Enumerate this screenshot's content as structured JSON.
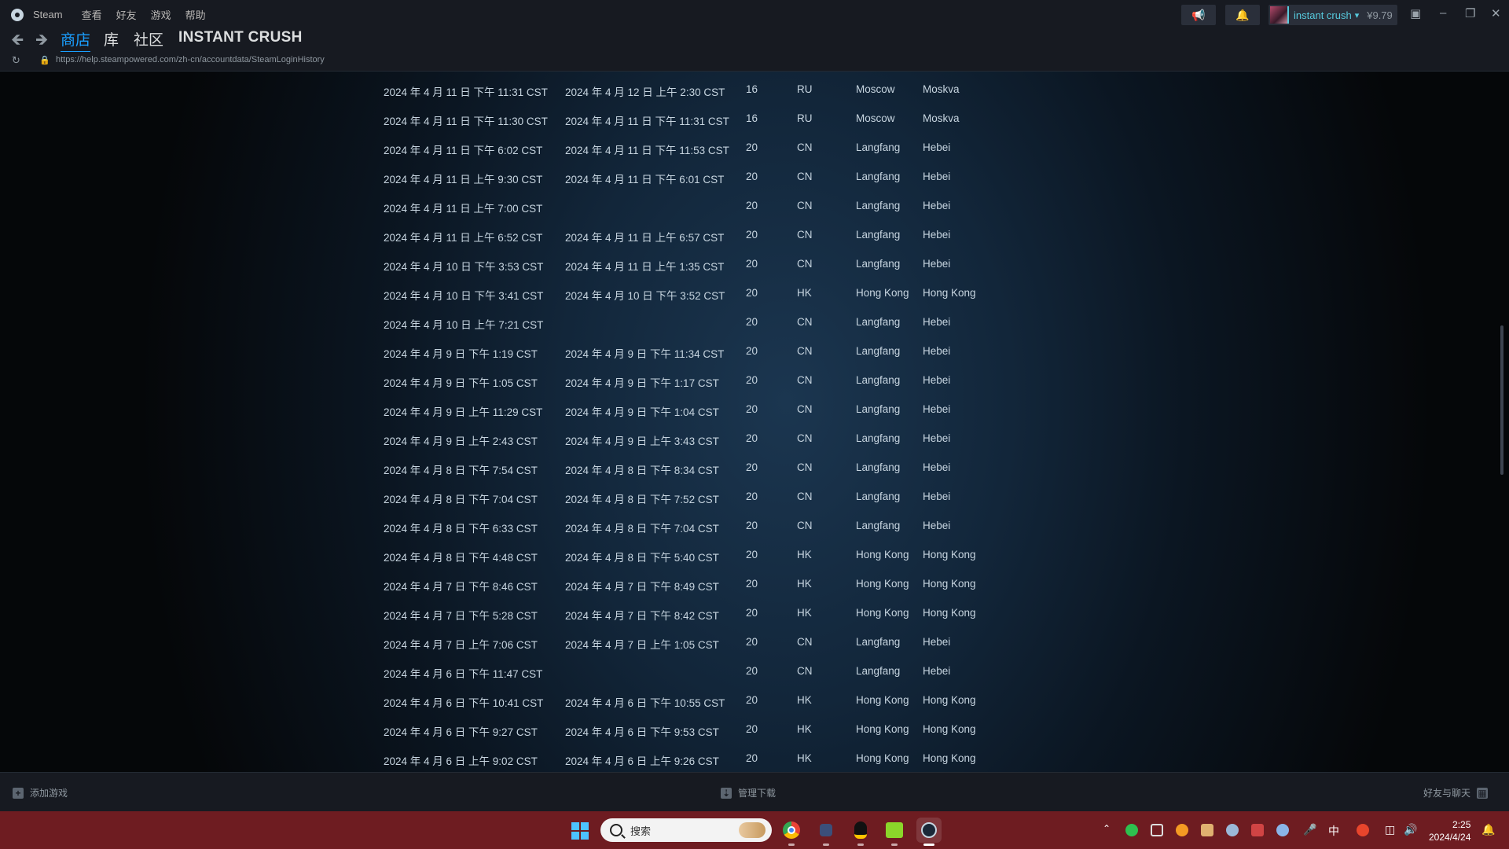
{
  "menu": {
    "app_name": "Steam",
    "items": [
      "查看",
      "好友",
      "游戏",
      "帮助"
    ]
  },
  "account": {
    "name": "instant crush",
    "balance": "¥9.79"
  },
  "nav": {
    "tabs": [
      "商店",
      "库",
      "社区"
    ],
    "active_tab": "商店",
    "username": "INSTANT CRUSH"
  },
  "url": "https://help.steampowered.com/zh-cn/accountdata/SteamLoginHistory",
  "login_history": {
    "rows": [
      {
        "start": "2024 年 4 月 11 日 下午 11:31 CST",
        "end": "2024 年 4 月 12 日 上午 2:30 CST",
        "type": "16",
        "country": "RU",
        "city": "Moscow",
        "region": "Moskva"
      },
      {
        "start": "2024 年 4 月 11 日 下午 11:30 CST",
        "end": "2024 年 4 月 11 日 下午 11:31 CST",
        "type": "16",
        "country": "RU",
        "city": "Moscow",
        "region": "Moskva"
      },
      {
        "start": "2024 年 4 月 11 日 下午 6:02 CST",
        "end": "2024 年 4 月 11 日 下午 11:53 CST",
        "type": "20",
        "country": "CN",
        "city": "Langfang",
        "region": "Hebei"
      },
      {
        "start": "2024 年 4 月 11 日 上午 9:30 CST",
        "end": "2024 年 4 月 11 日 下午 6:01 CST",
        "type": "20",
        "country": "CN",
        "city": "Langfang",
        "region": "Hebei"
      },
      {
        "start": "2024 年 4 月 11 日 上午 7:00 CST",
        "end": "",
        "type": "20",
        "country": "CN",
        "city": "Langfang",
        "region": "Hebei"
      },
      {
        "start": "2024 年 4 月 11 日 上午 6:52 CST",
        "end": "2024 年 4 月 11 日 上午 6:57 CST",
        "type": "20",
        "country": "CN",
        "city": "Langfang",
        "region": "Hebei"
      },
      {
        "start": "2024 年 4 月 10 日 下午 3:53 CST",
        "end": "2024 年 4 月 11 日 上午 1:35 CST",
        "type": "20",
        "country": "CN",
        "city": "Langfang",
        "region": "Hebei"
      },
      {
        "start": "2024 年 4 月 10 日 下午 3:41 CST",
        "end": "2024 年 4 月 10 日 下午 3:52 CST",
        "type": "20",
        "country": "HK",
        "city": "Hong Kong",
        "region": "Hong Kong"
      },
      {
        "start": "2024 年 4 月 10 日 上午 7:21 CST",
        "end": "",
        "type": "20",
        "country": "CN",
        "city": "Langfang",
        "region": "Hebei"
      },
      {
        "start": "2024 年 4 月 9 日 下午 1:19 CST",
        "end": "2024 年 4 月 9 日 下午 11:34 CST",
        "type": "20",
        "country": "CN",
        "city": "Langfang",
        "region": "Hebei"
      },
      {
        "start": "2024 年 4 月 9 日 下午 1:05 CST",
        "end": "2024 年 4 月 9 日 下午 1:17 CST",
        "type": "20",
        "country": "CN",
        "city": "Langfang",
        "region": "Hebei"
      },
      {
        "start": "2024 年 4 月 9 日 上午 11:29 CST",
        "end": "2024 年 4 月 9 日 下午 1:04 CST",
        "type": "20",
        "country": "CN",
        "city": "Langfang",
        "region": "Hebei"
      },
      {
        "start": "2024 年 4 月 9 日 上午 2:43 CST",
        "end": "2024 年 4 月 9 日 上午 3:43 CST",
        "type": "20",
        "country": "CN",
        "city": "Langfang",
        "region": "Hebei"
      },
      {
        "start": "2024 年 4 月 8 日 下午 7:54 CST",
        "end": "2024 年 4 月 8 日 下午 8:34 CST",
        "type": "20",
        "country": "CN",
        "city": "Langfang",
        "region": "Hebei"
      },
      {
        "start": "2024 年 4 月 8 日 下午 7:04 CST",
        "end": "2024 年 4 月 8 日 下午 7:52 CST",
        "type": "20",
        "country": "CN",
        "city": "Langfang",
        "region": "Hebei"
      },
      {
        "start": "2024 年 4 月 8 日 下午 6:33 CST",
        "end": "2024 年 4 月 8 日 下午 7:04 CST",
        "type": "20",
        "country": "CN",
        "city": "Langfang",
        "region": "Hebei"
      },
      {
        "start": "2024 年 4 月 8 日 下午 4:48 CST",
        "end": "2024 年 4 月 8 日 下午 5:40 CST",
        "type": "20",
        "country": "HK",
        "city": "Hong Kong",
        "region": "Hong Kong"
      },
      {
        "start": "2024 年 4 月 7 日 下午 8:46 CST",
        "end": "2024 年 4 月 7 日 下午 8:49 CST",
        "type": "20",
        "country": "HK",
        "city": "Hong Kong",
        "region": "Hong Kong"
      },
      {
        "start": "2024 年 4 月 7 日 下午 5:28 CST",
        "end": "2024 年 4 月 7 日 下午 8:42 CST",
        "type": "20",
        "country": "HK",
        "city": "Hong Kong",
        "region": "Hong Kong"
      },
      {
        "start": "2024 年 4 月 7 日 上午 7:06 CST",
        "end": "2024 年 4 月 7 日 上午 1:05 CST",
        "type": "20",
        "country": "CN",
        "city": "Langfang",
        "region": "Hebei"
      },
      {
        "start": "2024 年 4 月 6 日 下午 11:47 CST",
        "end": "",
        "type": "20",
        "country": "CN",
        "city": "Langfang",
        "region": "Hebei"
      },
      {
        "start": "2024 年 4 月 6 日 下午 10:41 CST",
        "end": "2024 年 4 月 6 日 下午 10:55 CST",
        "type": "20",
        "country": "HK",
        "city": "Hong Kong",
        "region": "Hong Kong"
      },
      {
        "start": "2024 年 4 月 6 日 下午 9:27 CST",
        "end": "2024 年 4 月 6 日 下午 9:53 CST",
        "type": "20",
        "country": "HK",
        "city": "Hong Kong",
        "region": "Hong Kong"
      },
      {
        "start": "2024 年 4 月 6 日 上午 9:02 CST",
        "end": "2024 年 4 月 6 日 上午 9:26 CST",
        "type": "20",
        "country": "HK",
        "city": "Hong Kong",
        "region": "Hong Kong"
      }
    ]
  },
  "statusbar": {
    "add_game": "添加游戏",
    "manage_downloads": "管理下载",
    "friends_chat": "好友与聊天"
  },
  "taskbar": {
    "search_placeholder": "搜索",
    "ime": "中",
    "time": "2:25",
    "date": "2024/4/24"
  },
  "colors": {
    "accent": "#1a9fff",
    "account_name": "#57cbde",
    "taskbar": "#6e1c21"
  }
}
